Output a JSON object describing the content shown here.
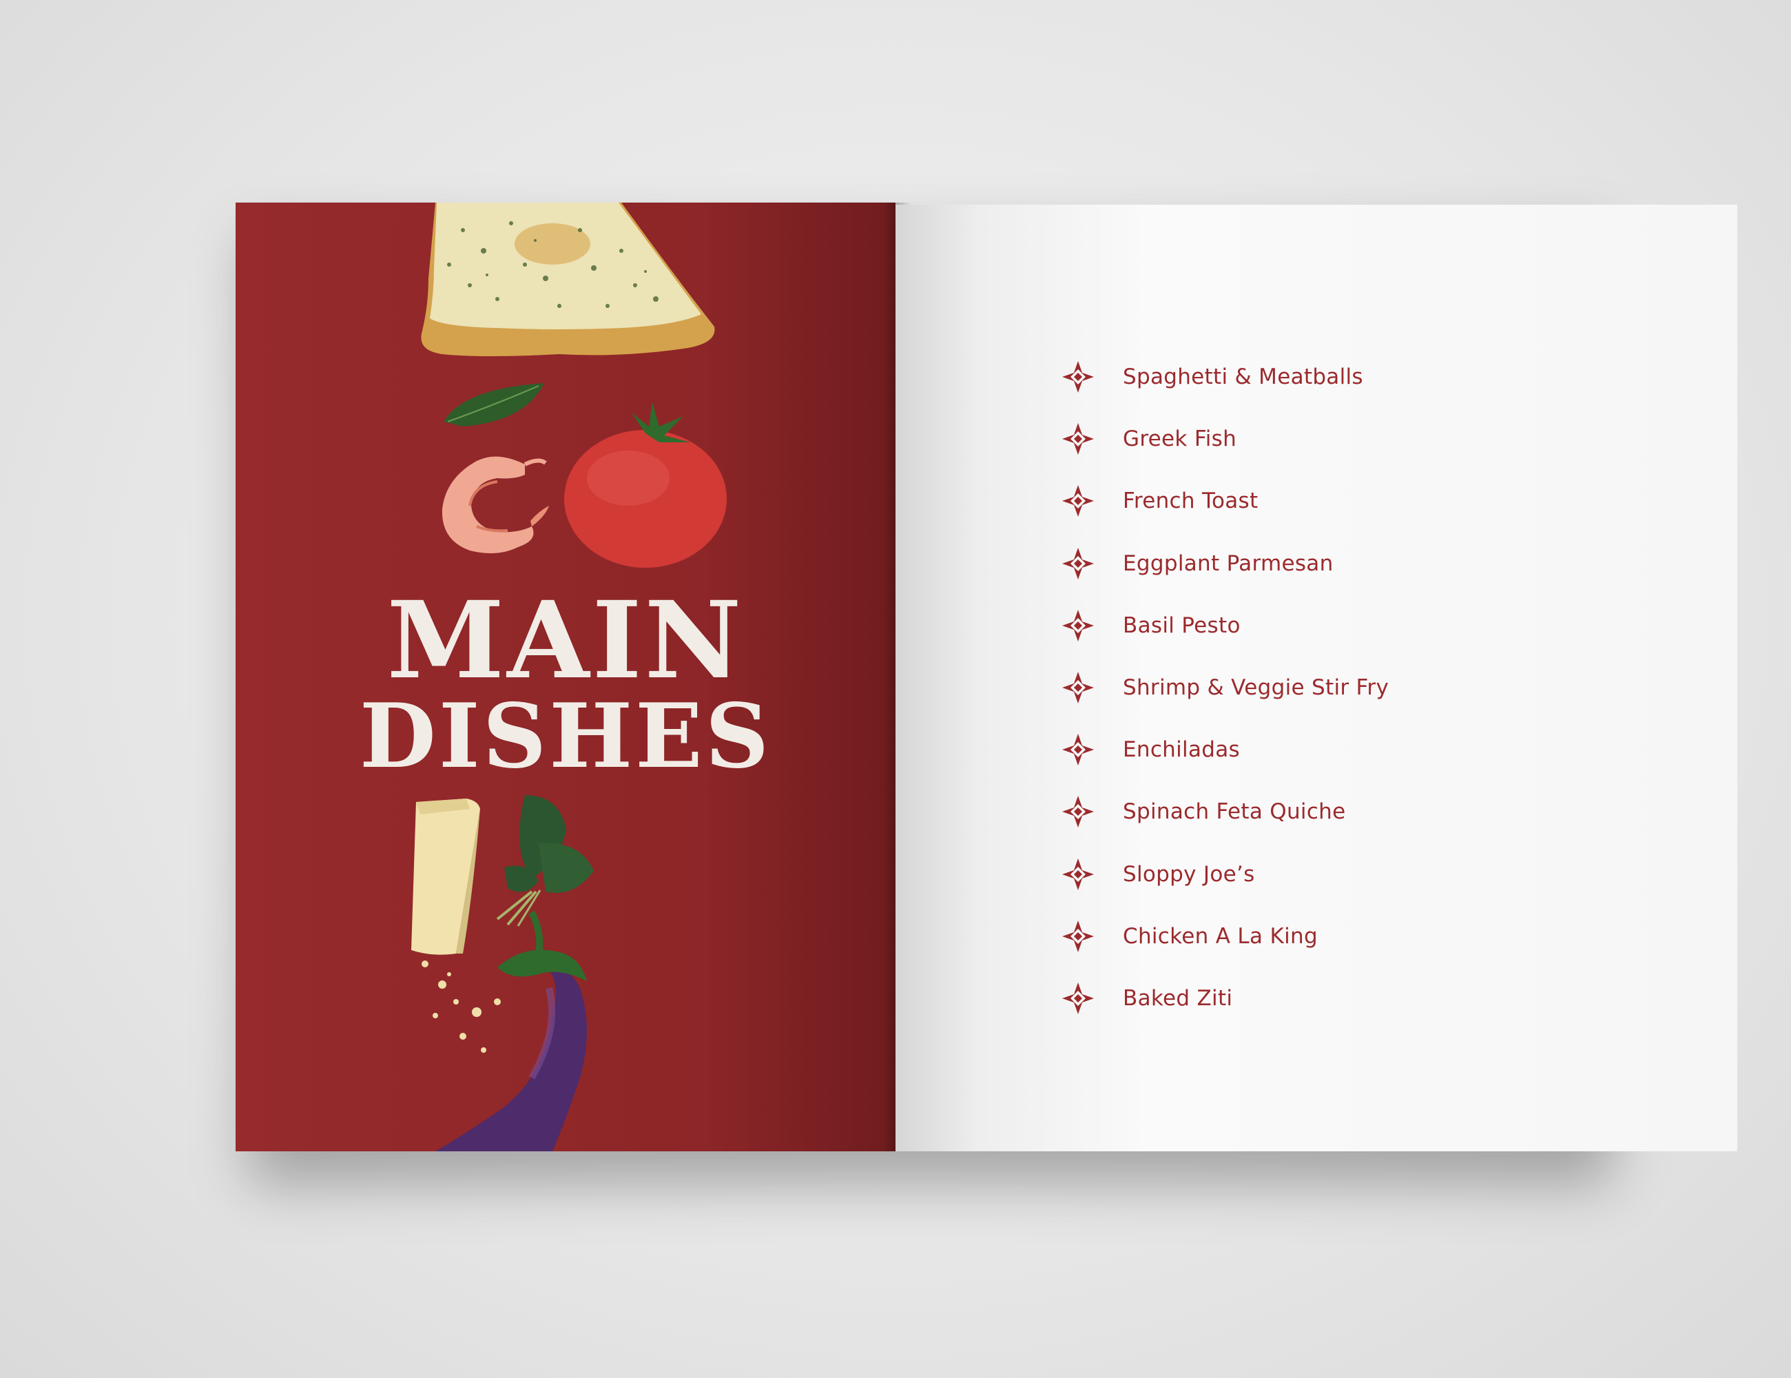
{
  "left_page": {
    "title_line1": "MAIN",
    "title_line2": "DISHES",
    "background_color": "#8d2628",
    "illustrations": [
      "flatbread",
      "basil-leaf",
      "shrimp",
      "tomato",
      "parmesan-wedge",
      "herb-bundle",
      "cheese-crumbs",
      "eggplant"
    ]
  },
  "right_page": {
    "accent_color": "#9b2a2d",
    "bullet_icon": "diamond-bullet-icon",
    "dishes": [
      {
        "label": "Spaghetti & Meatballs"
      },
      {
        "label": "Greek Fish"
      },
      {
        "label": "French Toast"
      },
      {
        "label": "Eggplant Parmesan"
      },
      {
        "label": "Basil Pesto"
      },
      {
        "label": "Shrimp & Veggie Stir Fry"
      },
      {
        "label": "Enchiladas"
      },
      {
        "label": "Spinach Feta Quiche"
      },
      {
        "label": "Sloppy Joe’s"
      },
      {
        "label": "Chicken A La King"
      },
      {
        "label": "Baked Ziti"
      }
    ]
  }
}
